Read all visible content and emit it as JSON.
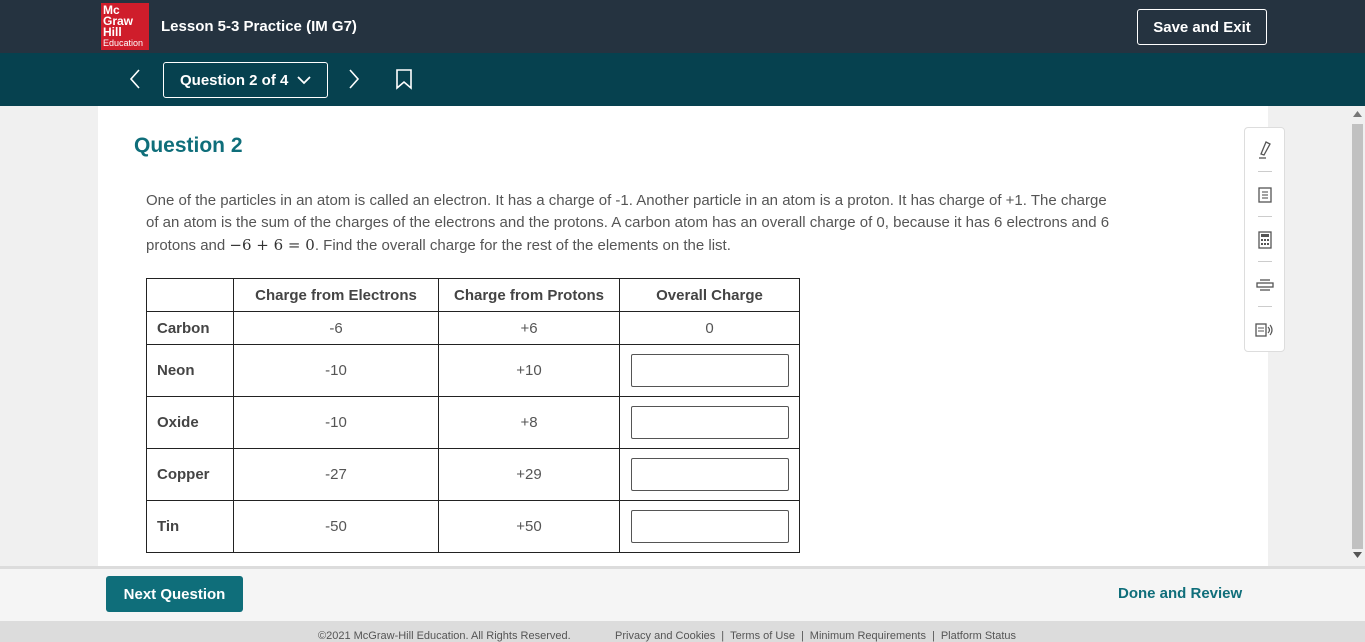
{
  "header": {
    "logo": [
      "Mc",
      "Graw",
      "Hill",
      "Education"
    ],
    "lesson_title": "Lesson 5-3 Practice (IM G7)",
    "save_exit_label": "Save and Exit"
  },
  "nav": {
    "question_selector": "Question 2 of 4"
  },
  "question": {
    "heading": "Question 2",
    "prompt_part1": "One of the particles in an atom is called an electron. It has a charge of -1. Another particle in an atom is a proton. It has charge of +1. The charge of an atom is the sum of the charges of the electrons and the protons. A carbon atom has an overall charge of 0, because it has 6 electrons and 6 protons and ",
    "prompt_math": "−6 + 6 = 0",
    "prompt_part2": ". Find the overall charge for the rest of the elements on the list."
  },
  "table": {
    "headers": [
      "",
      "Charge from Electrons",
      "Charge from Protons",
      "Overall Charge"
    ],
    "rows": [
      {
        "element": "Carbon",
        "electrons": "-6",
        "protons": "+6",
        "overall": "0",
        "has_input": false
      },
      {
        "element": "Neon",
        "electrons": "-10",
        "protons": "+10",
        "overall": "",
        "has_input": true
      },
      {
        "element": "Oxide",
        "electrons": "-10",
        "protons": "+8",
        "overall": "",
        "has_input": true
      },
      {
        "element": "Copper",
        "electrons": "-27",
        "protons": "+29",
        "overall": "",
        "has_input": true
      },
      {
        "element": "Tin",
        "electrons": "-50",
        "protons": "+50",
        "overall": "",
        "has_input": true
      }
    ]
  },
  "tools": [
    "highlighter-icon",
    "notepad-icon",
    "calculator-icon",
    "line-reader-icon",
    "text-to-speech-icon"
  ],
  "bottom": {
    "next_label": "Next Question",
    "done_label": "Done and Review"
  },
  "footer": {
    "copyright": "©2021 McGraw-Hill Education. All Rights Reserved.",
    "links": [
      "Privacy and Cookies",
      "Terms of Use",
      "Minimum Requirements",
      "Platform Status"
    ]
  },
  "colors": {
    "topbar": "#253340",
    "navbar": "#06414f",
    "accent": "#0f6e7a",
    "logo_red": "#cf1d2b"
  }
}
